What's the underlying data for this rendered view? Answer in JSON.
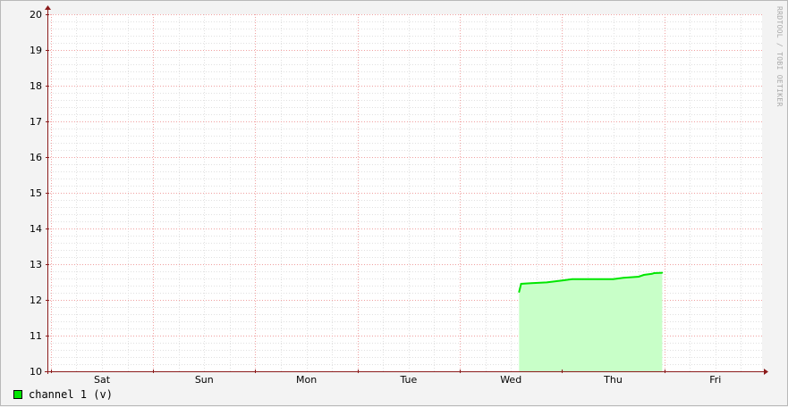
{
  "chart_data": {
    "type": "area",
    "watermark": "RRDTOOL / TOBI OETIKER",
    "y_ticks": [
      "10",
      "11",
      "12",
      "13",
      "14",
      "15",
      "16",
      "17",
      "18",
      "19",
      "20"
    ],
    "ylim": [
      10,
      20
    ],
    "x_ticks": [
      "Sat",
      "Sun",
      "Mon",
      "Tue",
      "Wed",
      "Thu",
      "Fri"
    ],
    "xlim_days": [
      0,
      7
    ],
    "grid": true,
    "legend_position": "bottom-left",
    "colors": {
      "line": "#00e600",
      "area": "#c8ffc8",
      "major_grid": "#f0a0a0",
      "minor_grid": "#e0e0e0",
      "axis": "#8b1a1a"
    },
    "series": [
      {
        "name": "channel 1 (v)",
        "x_days": [
          5.08,
          5.1,
          5.2,
          5.35,
          5.52,
          5.6,
          5.7,
          5.85,
          6.0,
          6.1,
          6.25,
          6.3,
          6.38,
          6.4,
          6.48
        ],
        "values": [
          12.22,
          12.45,
          12.47,
          12.49,
          12.55,
          12.58,
          12.58,
          12.58,
          12.58,
          12.62,
          12.65,
          12.7,
          12.73,
          12.75,
          12.76
        ]
      }
    ]
  }
}
